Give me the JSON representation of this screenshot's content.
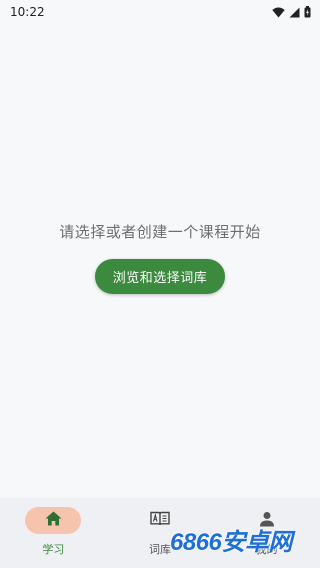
{
  "status_bar": {
    "time": "10:22",
    "icons": [
      "wifi-icon",
      "signal-icon",
      "battery-icon"
    ]
  },
  "empty_state": {
    "message": "请选择或者创建一个课程开始",
    "button_label": "浏览和选择词库"
  },
  "bottom_nav": {
    "items": [
      {
        "label": "学习",
        "icon": "home-icon",
        "active": true
      },
      {
        "label": "词库",
        "icon": "book-icon",
        "active": false
      },
      {
        "label": "我的",
        "icon": "person-icon",
        "active": false
      }
    ]
  },
  "watermark": {
    "text": "6866安卓网"
  },
  "colors": {
    "accent": "#3b8a3e",
    "active_pill": "#f6c3ad",
    "background": "#f7f8fa",
    "nav_background": "#eef0f4"
  }
}
